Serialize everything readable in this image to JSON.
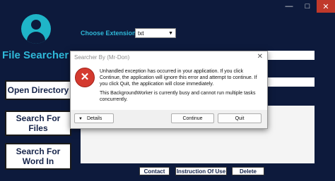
{
  "app": {
    "title": "File Searcher"
  },
  "sidebar": {
    "open_directory": "Open Directory",
    "search_files": "Search For Files",
    "search_word": "Search For Word In"
  },
  "extension": {
    "label": "Choose Extension :",
    "value": "txt"
  },
  "bottom_buttons": {
    "contact": "Contact",
    "instructions": "Instruction Of Use",
    "delete": "Delete"
  },
  "dialog": {
    "title": "Searcher By (Mr-Don)",
    "message1": "Unhandled exception has occurred in your application. If you click Continue, the application will ignore this error and attempt to continue. If you click Quit, the application will close immediately.",
    "message2": "This BackgroundWorker is currently busy and cannot run multiple tasks concurrently.",
    "details": "Details",
    "continue": "Continue",
    "quit": "Quit"
  },
  "colors": {
    "background": "#0d1a3c",
    "accent": "#2fb8d8",
    "error": "#d43a2f"
  },
  "icons": [
    "user-avatar-icon",
    "error-icon",
    "close-icon",
    "minimize-icon",
    "maximize-icon",
    "chevron-down-icon",
    "triangle-down-icon"
  ]
}
